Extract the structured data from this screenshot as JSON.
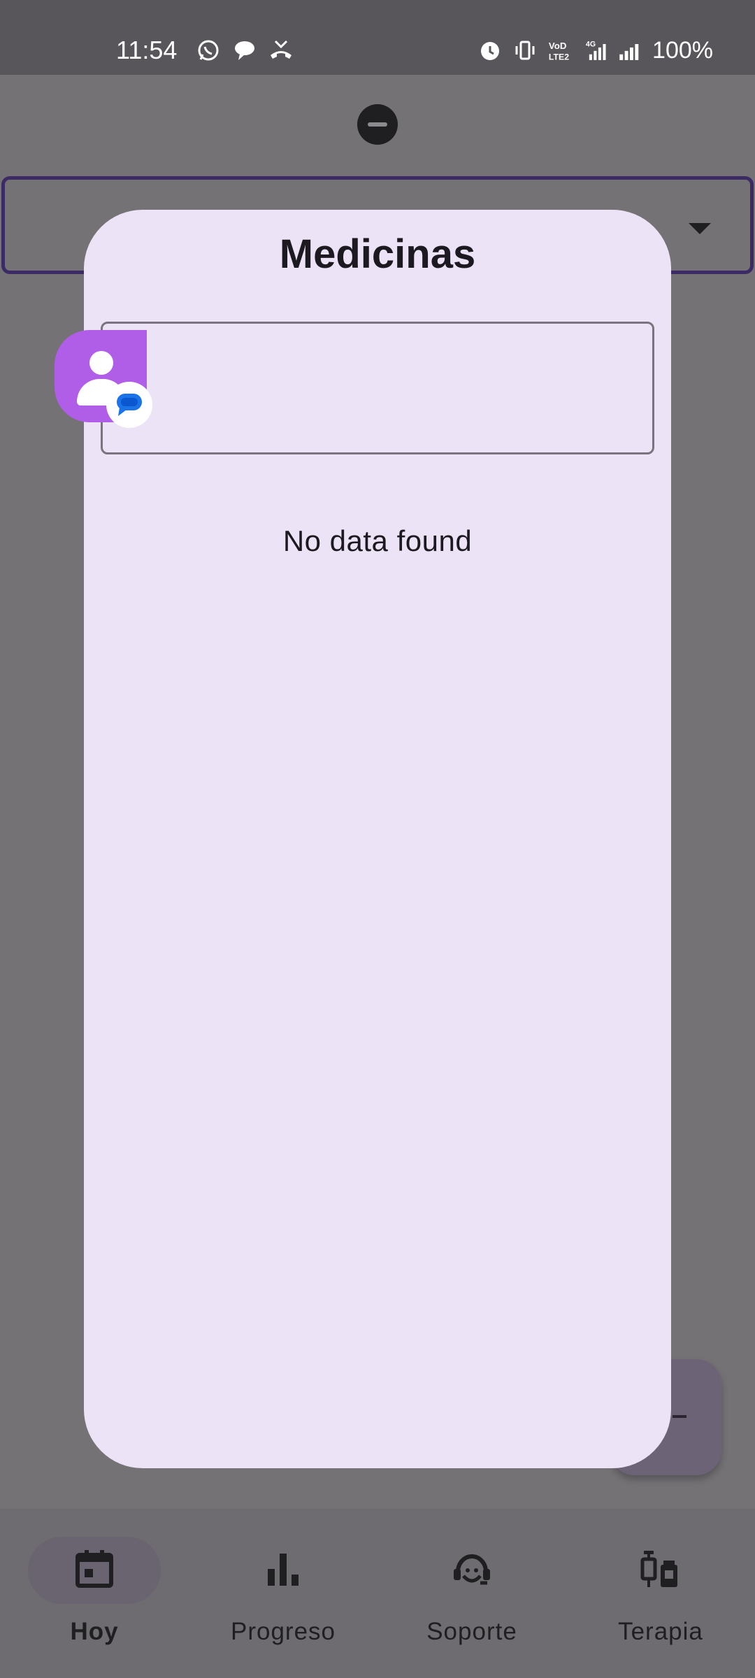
{
  "status_bar": {
    "time": "11:54",
    "left_icons": [
      "whatsapp-icon",
      "chat-bubble-icon",
      "missed-call-icon"
    ],
    "right_icons": [
      "alarm-icon",
      "vibrate-icon",
      "volte-icon",
      "4g-signal-icon",
      "signal-icon"
    ],
    "network_label": "4G",
    "volte_label": "VoLTE2",
    "battery": "100%"
  },
  "dialog": {
    "title": "Medicinas",
    "search_value": "",
    "empty_message": "No data found"
  },
  "bottom_nav": {
    "items": [
      {
        "label": "Hoy",
        "icon": "calendar-icon",
        "active": true
      },
      {
        "label": "Progreso",
        "icon": "bar-chart-icon",
        "active": false
      },
      {
        "label": "Soporte",
        "icon": "support-agent-icon",
        "active": false
      },
      {
        "label": "Terapia",
        "icon": "syringe-vial-icon",
        "active": false
      }
    ]
  },
  "colors": {
    "scrim": "#747275",
    "dialog_background": "#ece3f6",
    "chat_head": "#b05de8",
    "badge_blue": "#1a73e8",
    "outline_accent": "#3b2a63"
  }
}
